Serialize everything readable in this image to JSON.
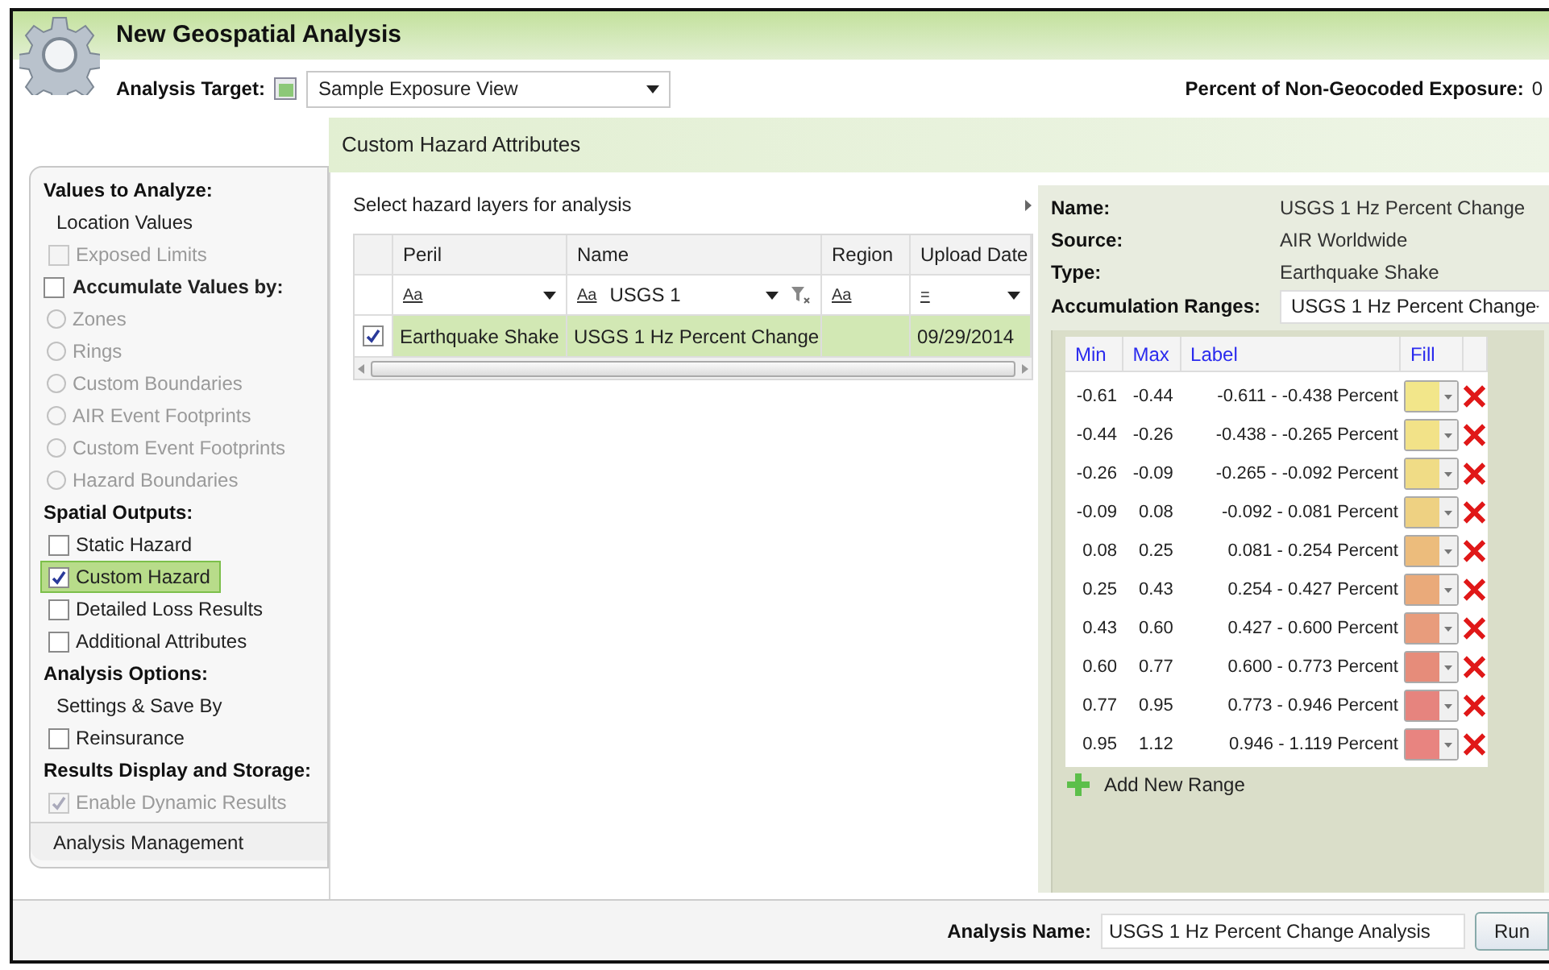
{
  "window": {
    "title": "New Geospatial Analysis"
  },
  "target": {
    "label": "Analysis Target:",
    "value": "Sample Exposure View"
  },
  "non_geocoded": {
    "label": "Percent of Non-Geocoded Exposure:",
    "value": "0"
  },
  "section_title": "Custom Hazard Attributes",
  "options": [
    {
      "kind": "heading",
      "label": "Values to Analyze:"
    },
    {
      "kind": "text",
      "label": "Location Values"
    },
    {
      "kind": "checkbox",
      "label": "Exposed Limits",
      "checked": false,
      "disabled": true,
      "selected": false
    },
    {
      "kind": "checkbox-heading",
      "label": "Accumulate Values by:",
      "checked": false,
      "disabled": false
    },
    {
      "kind": "radio",
      "label": "Zones",
      "checked": false,
      "disabled": true
    },
    {
      "kind": "radio",
      "label": "Rings",
      "checked": false,
      "disabled": true
    },
    {
      "kind": "radio",
      "label": "Custom Boundaries",
      "checked": false,
      "disabled": true
    },
    {
      "kind": "radio",
      "label": "AIR Event Footprints",
      "checked": false,
      "disabled": true
    },
    {
      "kind": "radio",
      "label": "Custom Event Footprints",
      "checked": false,
      "disabled": true
    },
    {
      "kind": "radio",
      "label": "Hazard Boundaries",
      "checked": false,
      "disabled": true
    },
    {
      "kind": "heading",
      "label": "Spatial Outputs:"
    },
    {
      "kind": "checkbox",
      "label": "Static Hazard",
      "checked": false,
      "disabled": false,
      "selected": false
    },
    {
      "kind": "checkbox",
      "label": "Custom Hazard",
      "checked": true,
      "disabled": false,
      "selected": true
    },
    {
      "kind": "checkbox",
      "label": "Detailed Loss Results",
      "checked": false,
      "disabled": false,
      "selected": false
    },
    {
      "kind": "checkbox",
      "label": "Additional Attributes",
      "checked": false,
      "disabled": false,
      "selected": false
    },
    {
      "kind": "heading",
      "label": "Analysis Options:"
    },
    {
      "kind": "text",
      "label": "Settings & Save By"
    },
    {
      "kind": "checkbox",
      "label": "Reinsurance",
      "checked": false,
      "disabled": false,
      "selected": false
    },
    {
      "kind": "heading",
      "label": "Results Display and Storage:"
    },
    {
      "kind": "checkbox",
      "label": "Enable Dynamic Results",
      "checked": true,
      "disabled": true,
      "selected": false
    }
  ],
  "management": "Analysis Management",
  "layers": {
    "title": "Select hazard layers for analysis",
    "columns": [
      "Peril",
      "Name",
      "Region",
      "Upload Date"
    ],
    "filters": [
      {
        "text": "Aa",
        "dropdown": true
      },
      {
        "text": "Aa",
        "value": "USGS 1",
        "dropdown": true
      },
      {
        "text": "Aa",
        "dropdown": false
      },
      {
        "text": "=",
        "dropdown": true
      }
    ],
    "rows": [
      {
        "checked": true,
        "selected": true,
        "cells": [
          "Earthquake Shake",
          "USGS 1 Hz Percent Change",
          "",
          "09/29/2014"
        ]
      }
    ]
  },
  "details": [
    {
      "label": "Name:",
      "value": "USGS 1 Hz Percent Change"
    },
    {
      "label": "Source:",
      "value": "AIR Worldwide"
    },
    {
      "label": "Type:",
      "value": "Earthquake Shake"
    }
  ],
  "ranges_label": "Accumulation Ranges:",
  "ranges_value": "USGS 1 Hz Percent Change",
  "range_columns": [
    "Min",
    "Max",
    "Label",
    "Fill"
  ],
  "ranges": [
    {
      "min": "-0.61",
      "max": "-0.44",
      "label": "-0.611 - -0.438 Percent",
      "color": "#f2e68a"
    },
    {
      "min": "-0.44",
      "max": "-0.26",
      "label": "-0.438 - -0.265 Percent",
      "color": "#f2e288"
    },
    {
      "min": "-0.26",
      "max": "-0.09",
      "label": "-0.265 - -0.092 Percent",
      "color": "#f0dc86"
    },
    {
      "min": "-0.09",
      "max": "0.08",
      "label": "-0.092 - 0.081 Percent",
      "color": "#eed182"
    },
    {
      "min": "0.08",
      "max": "0.25",
      "label": "0.081 - 0.254 Percent",
      "color": "#ecbc7c"
    },
    {
      "min": "0.25",
      "max": "0.43",
      "label": "0.254 - 0.427 Percent",
      "color": "#eaaa7a"
    },
    {
      "min": "0.43",
      "max": "0.60",
      "label": "0.427 - 0.600 Percent",
      "color": "#e89c7c"
    },
    {
      "min": "0.60",
      "max": "0.77",
      "label": "0.600 - 0.773 Percent",
      "color": "#e68c7a"
    },
    {
      "min": "0.77",
      "max": "0.95",
      "label": "0.773 - 0.946 Percent",
      "color": "#e6847e"
    },
    {
      "min": "0.95",
      "max": "1.12",
      "label": "0.946 - 1.119 Percent",
      "color": "#e88480"
    }
  ],
  "add_range": "Add New Range",
  "analysis_name": {
    "label": "Analysis Name:",
    "value": "USGS 1 Hz Percent Change Analysis"
  },
  "run": "Run"
}
